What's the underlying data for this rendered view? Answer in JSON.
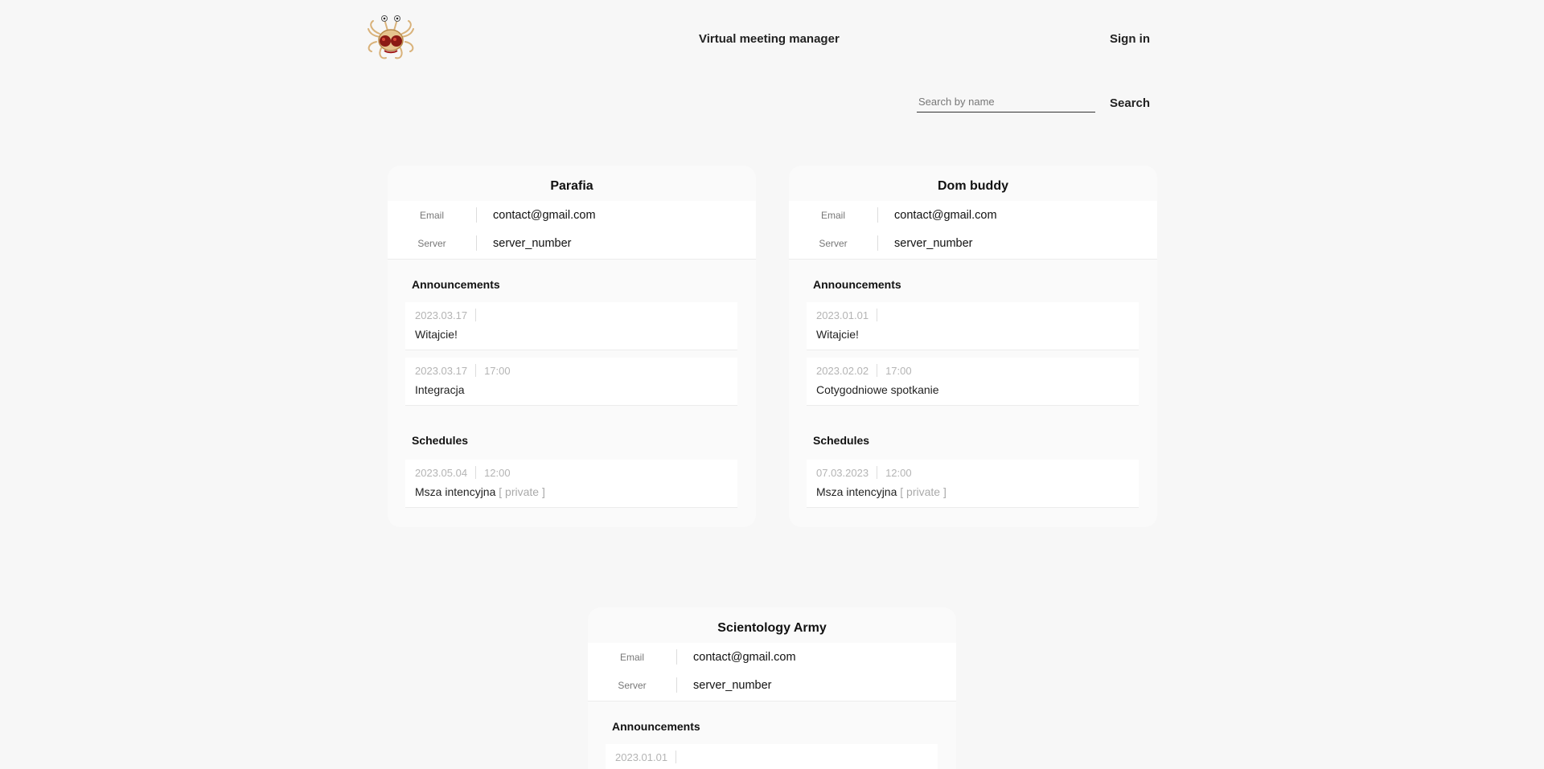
{
  "header": {
    "title": "Virtual meeting manager",
    "sign_in": "Sign in"
  },
  "search": {
    "placeholder": "Search by name",
    "value": "",
    "button": "Search"
  },
  "cards": [
    {
      "name": "Parafia",
      "email_label": "Email",
      "email": "contact@gmail.com",
      "server_label": "Server",
      "server": "server_number",
      "announcements_title": "Announcements",
      "announcements": [
        {
          "date": "2023.03.17",
          "time": "",
          "text": "Witajcie!"
        },
        {
          "date": "2023.03.17",
          "time": "17:00",
          "text": "Integracja"
        }
      ],
      "schedules_title": "Schedules",
      "schedules": [
        {
          "date": "2023.05.04",
          "time": "12:00",
          "text": "Msza intencyjna",
          "tag": "[ private ]"
        }
      ]
    },
    {
      "name": "Dom buddy",
      "email_label": "Email",
      "email": "contact@gmail.com",
      "server_label": "Server",
      "server": "server_number",
      "announcements_title": "Announcements",
      "announcements": [
        {
          "date": "2023.01.01",
          "time": "",
          "text": "Witajcie!"
        },
        {
          "date": "2023.02.02",
          "time": "17:00",
          "text": "Cotygodniowe spotkanie"
        }
      ],
      "schedules_title": "Schedules",
      "schedules": [
        {
          "date": "07.03.2023",
          "time": "12:00",
          "text": "Msza intencyjna",
          "tag": "[ private ]"
        }
      ]
    },
    {
      "name": "Scientology Army",
      "email_label": "Email",
      "email": "contact@gmail.com",
      "server_label": "Server",
      "server": "server_number",
      "announcements_title": "Announcements",
      "announcements": [
        {
          "date": "2023.01.01",
          "time": "",
          "text": ""
        }
      ]
    }
  ]
}
